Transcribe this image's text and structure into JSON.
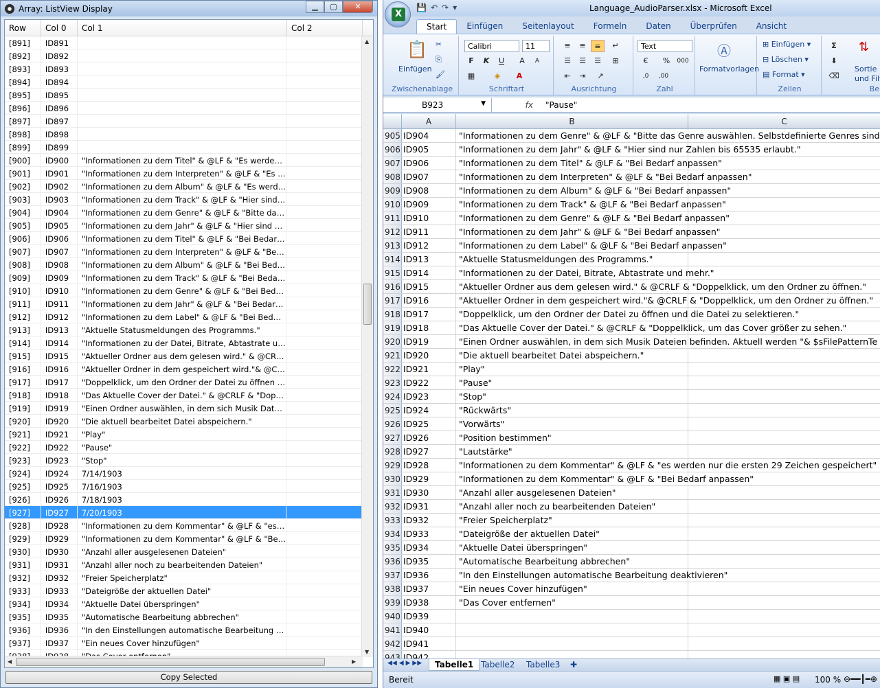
{
  "left_window": {
    "title": "Array: ListView Display",
    "columns": [
      "Row",
      "Col 0",
      "Col 1",
      "Col 2"
    ],
    "rows": [
      [
        "[891]",
        "ID891",
        ""
      ],
      [
        "[892]",
        "ID892",
        ""
      ],
      [
        "[893]",
        "ID893",
        ""
      ],
      [
        "[894]",
        "ID894",
        ""
      ],
      [
        "[895]",
        "ID895",
        ""
      ],
      [
        "[896]",
        "ID896",
        ""
      ],
      [
        "[897]",
        "ID897",
        ""
      ],
      [
        "[898]",
        "ID898",
        ""
      ],
      [
        "[899]",
        "ID899",
        ""
      ],
      [
        "[900]",
        "ID900",
        "\"Informationen zu dem Titel\" & @LF & \"Es werden nu..."
      ],
      [
        "[901]",
        "ID901",
        "\"Informationen zu dem Interpreten\" & @LF & \"Es wer..."
      ],
      [
        "[902]",
        "ID902",
        "\"Informationen zu dem Album\" & @LF & \"Es werden ..."
      ],
      [
        "[903]",
        "ID903",
        "\"Informationen zu dem Track\" & @LF & \"Hier sind nu..."
      ],
      [
        "[904]",
        "ID904",
        "\"Informationen zu dem Genre\" & @LF & \"Bitte das Ge..."
      ],
      [
        "[905]",
        "ID905",
        "\"Informationen zu dem Jahr\" & @LF & \"Hier sind nur ..."
      ],
      [
        "[906]",
        "ID906",
        "\"Informationen zu dem Titel\" & @LF & \"Bei Bedarf an..."
      ],
      [
        "[907]",
        "ID907",
        "\"Informationen zu dem Interpreten\" & @LF & \"Bei Be..."
      ],
      [
        "[908]",
        "ID908",
        "\"Informationen zu dem Album\" & @LF & \"Bei Bedarf ..."
      ],
      [
        "[909]",
        "ID909",
        "\"Informationen zu dem Track\" & @LF & \"Bei Bedarf a..."
      ],
      [
        "[910]",
        "ID910",
        "\"Informationen zu dem Genre\" & @LF & \"Bei Bedarf a..."
      ],
      [
        "[911]",
        "ID911",
        "\"Informationen zu dem Jahr\" & @LF & \"Bei Bedarf an..."
      ],
      [
        "[912]",
        "ID912",
        "\"Informationen zu dem Label\" & @LF & \"Bei Bedarf a..."
      ],
      [
        "[913]",
        "ID913",
        "\"Aktuelle Statusmeldungen des Programms.\""
      ],
      [
        "[914]",
        "ID914",
        "\"Informationen zu der Datei, Bitrate, Abtastrate und m..."
      ],
      [
        "[915]",
        "ID915",
        "\"Aktueller Ordner aus dem gelesen wird.\" & @CRLF &..."
      ],
      [
        "[916]",
        "ID916",
        "\"Aktueller Ordner in dem gespeichert wird.\"& @CRLF ..."
      ],
      [
        "[917]",
        "ID917",
        "\"Doppelklick, um den Ordner der Datei zu öffnen und ..."
      ],
      [
        "[918]",
        "ID918",
        "\"Das Aktuelle Cover der Datei.\" & @CRLF & \"Doppelkl..."
      ],
      [
        "[919]",
        "ID919",
        "\"Einen Ordner auswählen, in dem sich Musik Dateien ..."
      ],
      [
        "[920]",
        "ID920",
        "\"Die aktuell bearbeitet Datei abspeichern.\""
      ],
      [
        "[921]",
        "ID921",
        "\"Play\""
      ],
      [
        "[922]",
        "ID922",
        "\"Pause\""
      ],
      [
        "[923]",
        "ID923",
        "\"Stop\""
      ],
      [
        "[924]",
        "ID924",
        "7/14/1903"
      ],
      [
        "[925]",
        "ID925",
        "7/16/1903"
      ],
      [
        "[926]",
        "ID926",
        "7/18/1903"
      ],
      [
        "[927]",
        "ID927",
        "7/20/1903"
      ],
      [
        "[928]",
        "ID928",
        "\"Informationen zu dem Kommentar\" & @LF & \"es we..."
      ],
      [
        "[929]",
        "ID929",
        "\"Informationen zu dem Kommentar\" & @LF & \"Bei B..."
      ],
      [
        "[930]",
        "ID930",
        "\"Anzahl aller ausgelesenen Dateien\""
      ],
      [
        "[931]",
        "ID931",
        "\"Anzahl aller noch zu bearbeitenden Dateien\""
      ],
      [
        "[932]",
        "ID932",
        "\"Freier Speicherplatz\""
      ],
      [
        "[933]",
        "ID933",
        "\"Dateigröße der aktuellen Datei\""
      ],
      [
        "[934]",
        "ID934",
        "\"Aktuelle Datei überspringen\""
      ],
      [
        "[935]",
        "ID935",
        "\"Automatische Bearbeitung abbrechen\""
      ],
      [
        "[936]",
        "ID936",
        "\"In den Einstellungen automatische Bearbeitung deak..."
      ],
      [
        "[937]",
        "ID937",
        "\"Ein neues Cover hinzufügen\""
      ],
      [
        "[938]",
        "ID938",
        "\"Das Cover entfernen\""
      ]
    ],
    "selected_row": "[927]",
    "copy_button": "Copy Selected"
  },
  "excel": {
    "title": "Language_AudioParser.xlsx - Microsoft Excel",
    "tabs": [
      "Start",
      "Einfügen",
      "Seitenlayout",
      "Formeln",
      "Daten",
      "Überprüfen",
      "Ansicht"
    ],
    "ribbon": {
      "paste": "Einfügen",
      "clipboard": "Zwischenablage",
      "font_name": "Calibri",
      "font_size": "11",
      "font_group": "Schriftart",
      "align_group": "Ausrichtung",
      "number_format": "Text",
      "number_group": "Zahl",
      "styles": "Formatvorlagen",
      "insert": "Einfügen",
      "delete": "Löschen",
      "format": "Format",
      "cells_group": "Zellen",
      "sort": "Sortie",
      "sort2": "und Filt",
      "edit_group": "Be"
    },
    "name_box": "B923",
    "formula": "\"Pause\"",
    "columns": [
      "A",
      "B",
      "C"
    ],
    "rows": [
      [
        "905",
        "ID904",
        "\"Informationen zu dem Genre\" & @LF & \"Bitte das Genre auswählen. Selbstdefinierte Genres sind m"
      ],
      [
        "906",
        "ID905",
        "\"Informationen zu dem Jahr\" & @LF & \"Hier sind nur Zahlen bis 65535 erlaubt.\""
      ],
      [
        "907",
        "ID906",
        "\"Informationen zu dem Titel\" & @LF & \"Bei Bedarf anpassen\""
      ],
      [
        "908",
        "ID907",
        "\"Informationen zu dem Interpreten\" & @LF & \"Bei Bedarf anpassen\""
      ],
      [
        "909",
        "ID908",
        "\"Informationen zu dem Album\" & @LF & \"Bei Bedarf anpassen\""
      ],
      [
        "910",
        "ID909",
        "\"Informationen zu dem Track\" & @LF & \"Bei Bedarf anpassen\""
      ],
      [
        "911",
        "ID910",
        "\"Informationen zu dem Genre\" & @LF & \"Bei Bedarf anpassen\""
      ],
      [
        "912",
        "ID911",
        "\"Informationen zu dem Jahr\" & @LF & \"Bei Bedarf anpassen\""
      ],
      [
        "913",
        "ID912",
        "\"Informationen zu dem Label\" & @LF & \"Bei Bedarf anpassen\""
      ],
      [
        "914",
        "ID913",
        "\"Aktuelle Statusmeldungen des Programms.\""
      ],
      [
        "915",
        "ID914",
        "\"Informationen zu der Datei, Bitrate, Abtastrate und mehr.\""
      ],
      [
        "916",
        "ID915",
        "\"Aktueller Ordner aus dem gelesen wird.\" & @CRLF & \"Doppelklick, um den Ordner zu öffnen.\""
      ],
      [
        "917",
        "ID916",
        "\"Aktueller Ordner in dem gespeichert wird.\"& @CRLF & \"Doppelklick, um den Ordner zu öffnen.\""
      ],
      [
        "918",
        "ID917",
        "\"Doppelklick, um den Ordner der Datei zu öffnen und die Datei zu selektieren.\""
      ],
      [
        "919",
        "ID918",
        "\"Das Aktuelle Cover der Datei.\" & @CRLF & \"Doppelklick, um das Cover größer zu sehen.\""
      ],
      [
        "920",
        "ID919",
        "\"Einen Ordner auswählen, in dem sich Musik Dateien befinden. Aktuell werden \"& $sFilePatternTe"
      ],
      [
        "921",
        "ID920",
        "\"Die aktuell bearbeitet Datei abspeichern.\""
      ],
      [
        "922",
        "ID921",
        "\"Play\""
      ],
      [
        "923",
        "ID922",
        "\"Pause\""
      ],
      [
        "924",
        "ID923",
        "\"Stop\""
      ],
      [
        "925",
        "ID924",
        "\"Rückwärts\""
      ],
      [
        "926",
        "ID925",
        "\"Vorwärts\""
      ],
      [
        "927",
        "ID926",
        "\"Position bestimmen\""
      ],
      [
        "928",
        "ID927",
        "\"Lautstärke\""
      ],
      [
        "929",
        "ID928",
        "\"Informationen zu dem Kommentar\" & @LF & \"es werden nur die ersten 29 Zeichen gespeichert\""
      ],
      [
        "930",
        "ID929",
        "\"Informationen zu dem Kommentar\" & @LF & \"Bei Bedarf anpassen\""
      ],
      [
        "931",
        "ID930",
        "\"Anzahl aller ausgelesenen Dateien\""
      ],
      [
        "932",
        "ID931",
        "\"Anzahl aller noch zu bearbeitenden Dateien\""
      ],
      [
        "933",
        "ID932",
        "\"Freier Speicherplatz\""
      ],
      [
        "934",
        "ID933",
        "\"Dateigröße der aktuellen Datei\""
      ],
      [
        "935",
        "ID934",
        "\"Aktuelle Datei überspringen\""
      ],
      [
        "936",
        "ID935",
        "\"Automatische Bearbeitung abbrechen\""
      ],
      [
        "937",
        "ID936",
        "\"In den Einstellungen automatische Bearbeitung deaktivieren\""
      ],
      [
        "938",
        "ID937",
        "\"Ein neues Cover hinzufügen\""
      ],
      [
        "939",
        "ID938",
        "\"Das Cover entfernen\""
      ],
      [
        "940",
        "ID939",
        ""
      ],
      [
        "941",
        "ID940",
        ""
      ],
      [
        "942",
        "ID941",
        ""
      ],
      [
        "943",
        "ID942",
        ""
      ]
    ],
    "sheets": [
      "Tabelle1",
      "Tabelle2",
      "Tabelle3"
    ],
    "status": "Bereit",
    "zoom": "100 %"
  }
}
